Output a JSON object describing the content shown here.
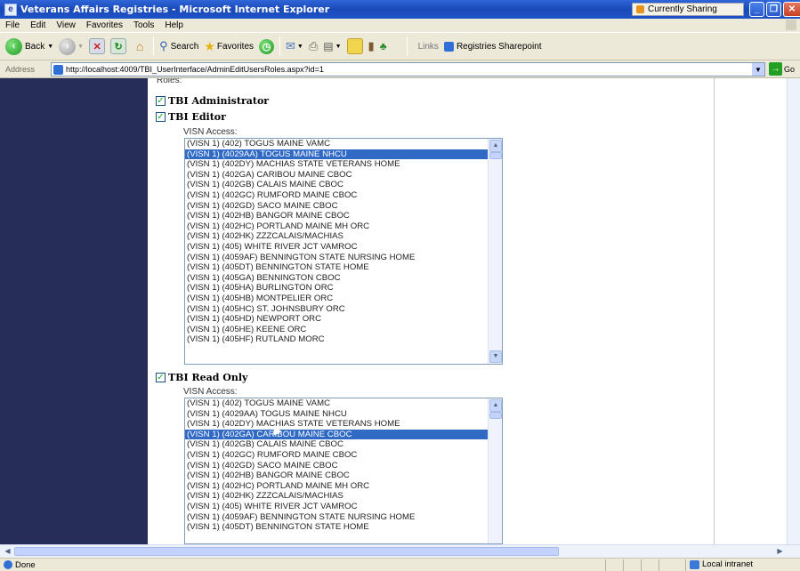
{
  "window": {
    "title": "Veterans Affairs Registries - Microsoft Internet Explorer",
    "sharing_label": "Currently Sharing"
  },
  "menu": [
    "File",
    "Edit",
    "View",
    "Favorites",
    "Tools",
    "Help"
  ],
  "toolbar": {
    "back_label": "Back",
    "search_label": "Search",
    "favorites_label": "Favorites",
    "links_label": "Links",
    "link_item": "Registries Sharepoint"
  },
  "address": {
    "label": "Address",
    "url": "http://localhost:4009/TBI_UserInterface/AdminEditUsersRoles.aspx?id=1",
    "go_label": "Go"
  },
  "page": {
    "roles_label": "Roles:",
    "roles": [
      {
        "label": "TBI Administrator",
        "checked": true
      },
      {
        "label": "TBI Editor",
        "checked": true,
        "visn_label": "VISN Access:",
        "selected_index": 1,
        "items": [
          "(VISN 1) (402) TOGUS MAINE VAMC",
          "(VISN 1) (4029AA) TOGUS MAINE NHCU",
          "(VISN 1) (402DY) MACHIAS STATE VETERANS HOME",
          "(VISN 1) (402GA) CARIBOU MAINE CBOC",
          "(VISN 1) (402GB) CALAIS MAINE CBOC",
          "(VISN 1) (402GC) RUMFORD MAINE CBOC",
          "(VISN 1) (402GD) SACO MAINE CBOC",
          "(VISN 1) (402HB) BANGOR MAINE CBOC",
          "(VISN 1) (402HC) PORTLAND MAINE MH ORC",
          "(VISN 1) (402HK) ZZZCALAIS/MACHIAS",
          "(VISN 1) (405) WHITE RIVER JCT VAMROC",
          "(VISN 1) (4059AF) BENNINGTON STATE NURSING HOME",
          "(VISN 1) (405DT) BENNINGTON STATE HOME",
          "(VISN 1) (405GA) BENNINGTON CBOC",
          "(VISN 1) (405HA) BURLINGTON ORC",
          "(VISN 1) (405HB) MONTPELIER ORC",
          "(VISN 1) (405HC) ST. JOHNSBURY ORC",
          "(VISN 1) (405HD) NEWPORT ORC",
          "(VISN 1) (405HE) KEENE ORC",
          "(VISN 1) (405HF) RUTLAND MORC"
        ]
      },
      {
        "label": "TBI Read Only",
        "checked": true,
        "visn_label": "VISN Access:",
        "selected_index": 3,
        "items": [
          "(VISN 1) (402) TOGUS MAINE VAMC",
          "(VISN 1) (4029AA) TOGUS MAINE NHCU",
          "(VISN 1) (402DY) MACHIAS STATE VETERANS HOME",
          "(VISN 1) (402GA) CARIBOU MAINE CBOC",
          "(VISN 1) (402GB) CALAIS MAINE CBOC",
          "(VISN 1) (402GC) RUMFORD MAINE CBOC",
          "(VISN 1) (402GD) SACO MAINE CBOC",
          "(VISN 1) (402HB) BANGOR MAINE CBOC",
          "(VISN 1) (402HC) PORTLAND MAINE MH ORC",
          "(VISN 1) (402HK) ZZZCALAIS/MACHIAS",
          "(VISN 1) (405) WHITE RIVER JCT VAMROC",
          "(VISN 1) (4059AF) BENNINGTON STATE NURSING HOME",
          "(VISN 1) (405DT) BENNINGTON STATE HOME"
        ]
      }
    ]
  },
  "status": {
    "text": "Done",
    "zone": "Local intranet"
  },
  "colors": {
    "nav_bg": "#272d59",
    "selection": "#316ac5",
    "title_bar": "#1a49b8"
  }
}
